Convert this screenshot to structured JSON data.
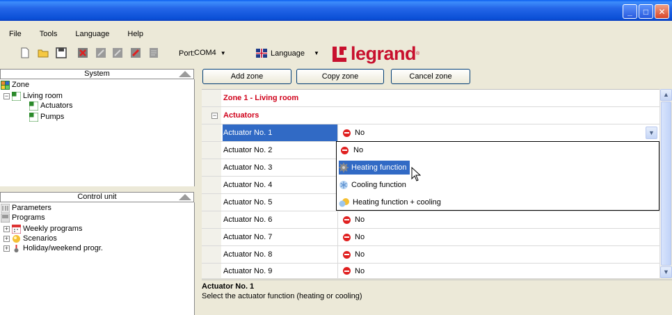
{
  "menu": [
    "File",
    "Tools",
    "Language",
    "Help"
  ],
  "toolbar": {
    "icons": [
      "new-file-icon",
      "open-folder-icon",
      "save-icon",
      "delete-icon",
      "disabled-tool-icon",
      "disabled-tool-icon",
      "edit-icon",
      "disabled-tool-icon"
    ],
    "port_label": "Port:",
    "port_value": "COM4",
    "language_label": "Language",
    "logo_text": "legrand",
    "logo_reg": "®"
  },
  "colors": {
    "selection": "#316ac5",
    "brand": "#c8102e",
    "header_red": "#d0021b"
  },
  "system_panel": {
    "title": "System",
    "tree": [
      {
        "label": "Zone",
        "level": 0,
        "expander": ""
      },
      {
        "label": "Living room",
        "level": 1,
        "expander": "−"
      },
      {
        "label": "Actuators",
        "level": 2,
        "expander": ""
      },
      {
        "label": "Pumps",
        "level": 2,
        "expander": ""
      }
    ]
  },
  "control_panel": {
    "title": "Control unit",
    "tree": [
      {
        "label": "Parameters",
        "expander": ""
      },
      {
        "label": "Programs",
        "expander": ""
      },
      {
        "label": "Weekly programs",
        "expander": "+"
      },
      {
        "label": "Scenarios",
        "expander": "+"
      },
      {
        "label": "Holiday/weekend progr.",
        "expander": "+"
      }
    ]
  },
  "actions": {
    "add": "Add zone",
    "copy": "Copy zone",
    "cancel": "Cancel zone"
  },
  "grid": {
    "zone_title": "Zone 1 - Living room",
    "group": "Actuators",
    "group_expander": "−",
    "rows": [
      {
        "name": "Actuator No. 1",
        "value": "No"
      },
      {
        "name": "Actuator No. 2",
        "value": ""
      },
      {
        "name": "Actuator No. 3",
        "value": ""
      },
      {
        "name": "Actuator No. 4",
        "value": ""
      },
      {
        "name": "Actuator No. 5",
        "value": ""
      },
      {
        "name": "Actuator No. 6",
        "value": "No"
      },
      {
        "name": "Actuator No. 7",
        "value": "No"
      },
      {
        "name": "Actuator No. 8",
        "value": "No"
      },
      {
        "name": "Actuator No. 9",
        "value": "No"
      }
    ],
    "options": [
      "No",
      "Heating function",
      "Cooling function",
      "Heating function + cooling"
    ]
  },
  "info": {
    "title": "Actuator No. 1",
    "description": "Select the actuator function (heating or cooling)"
  }
}
